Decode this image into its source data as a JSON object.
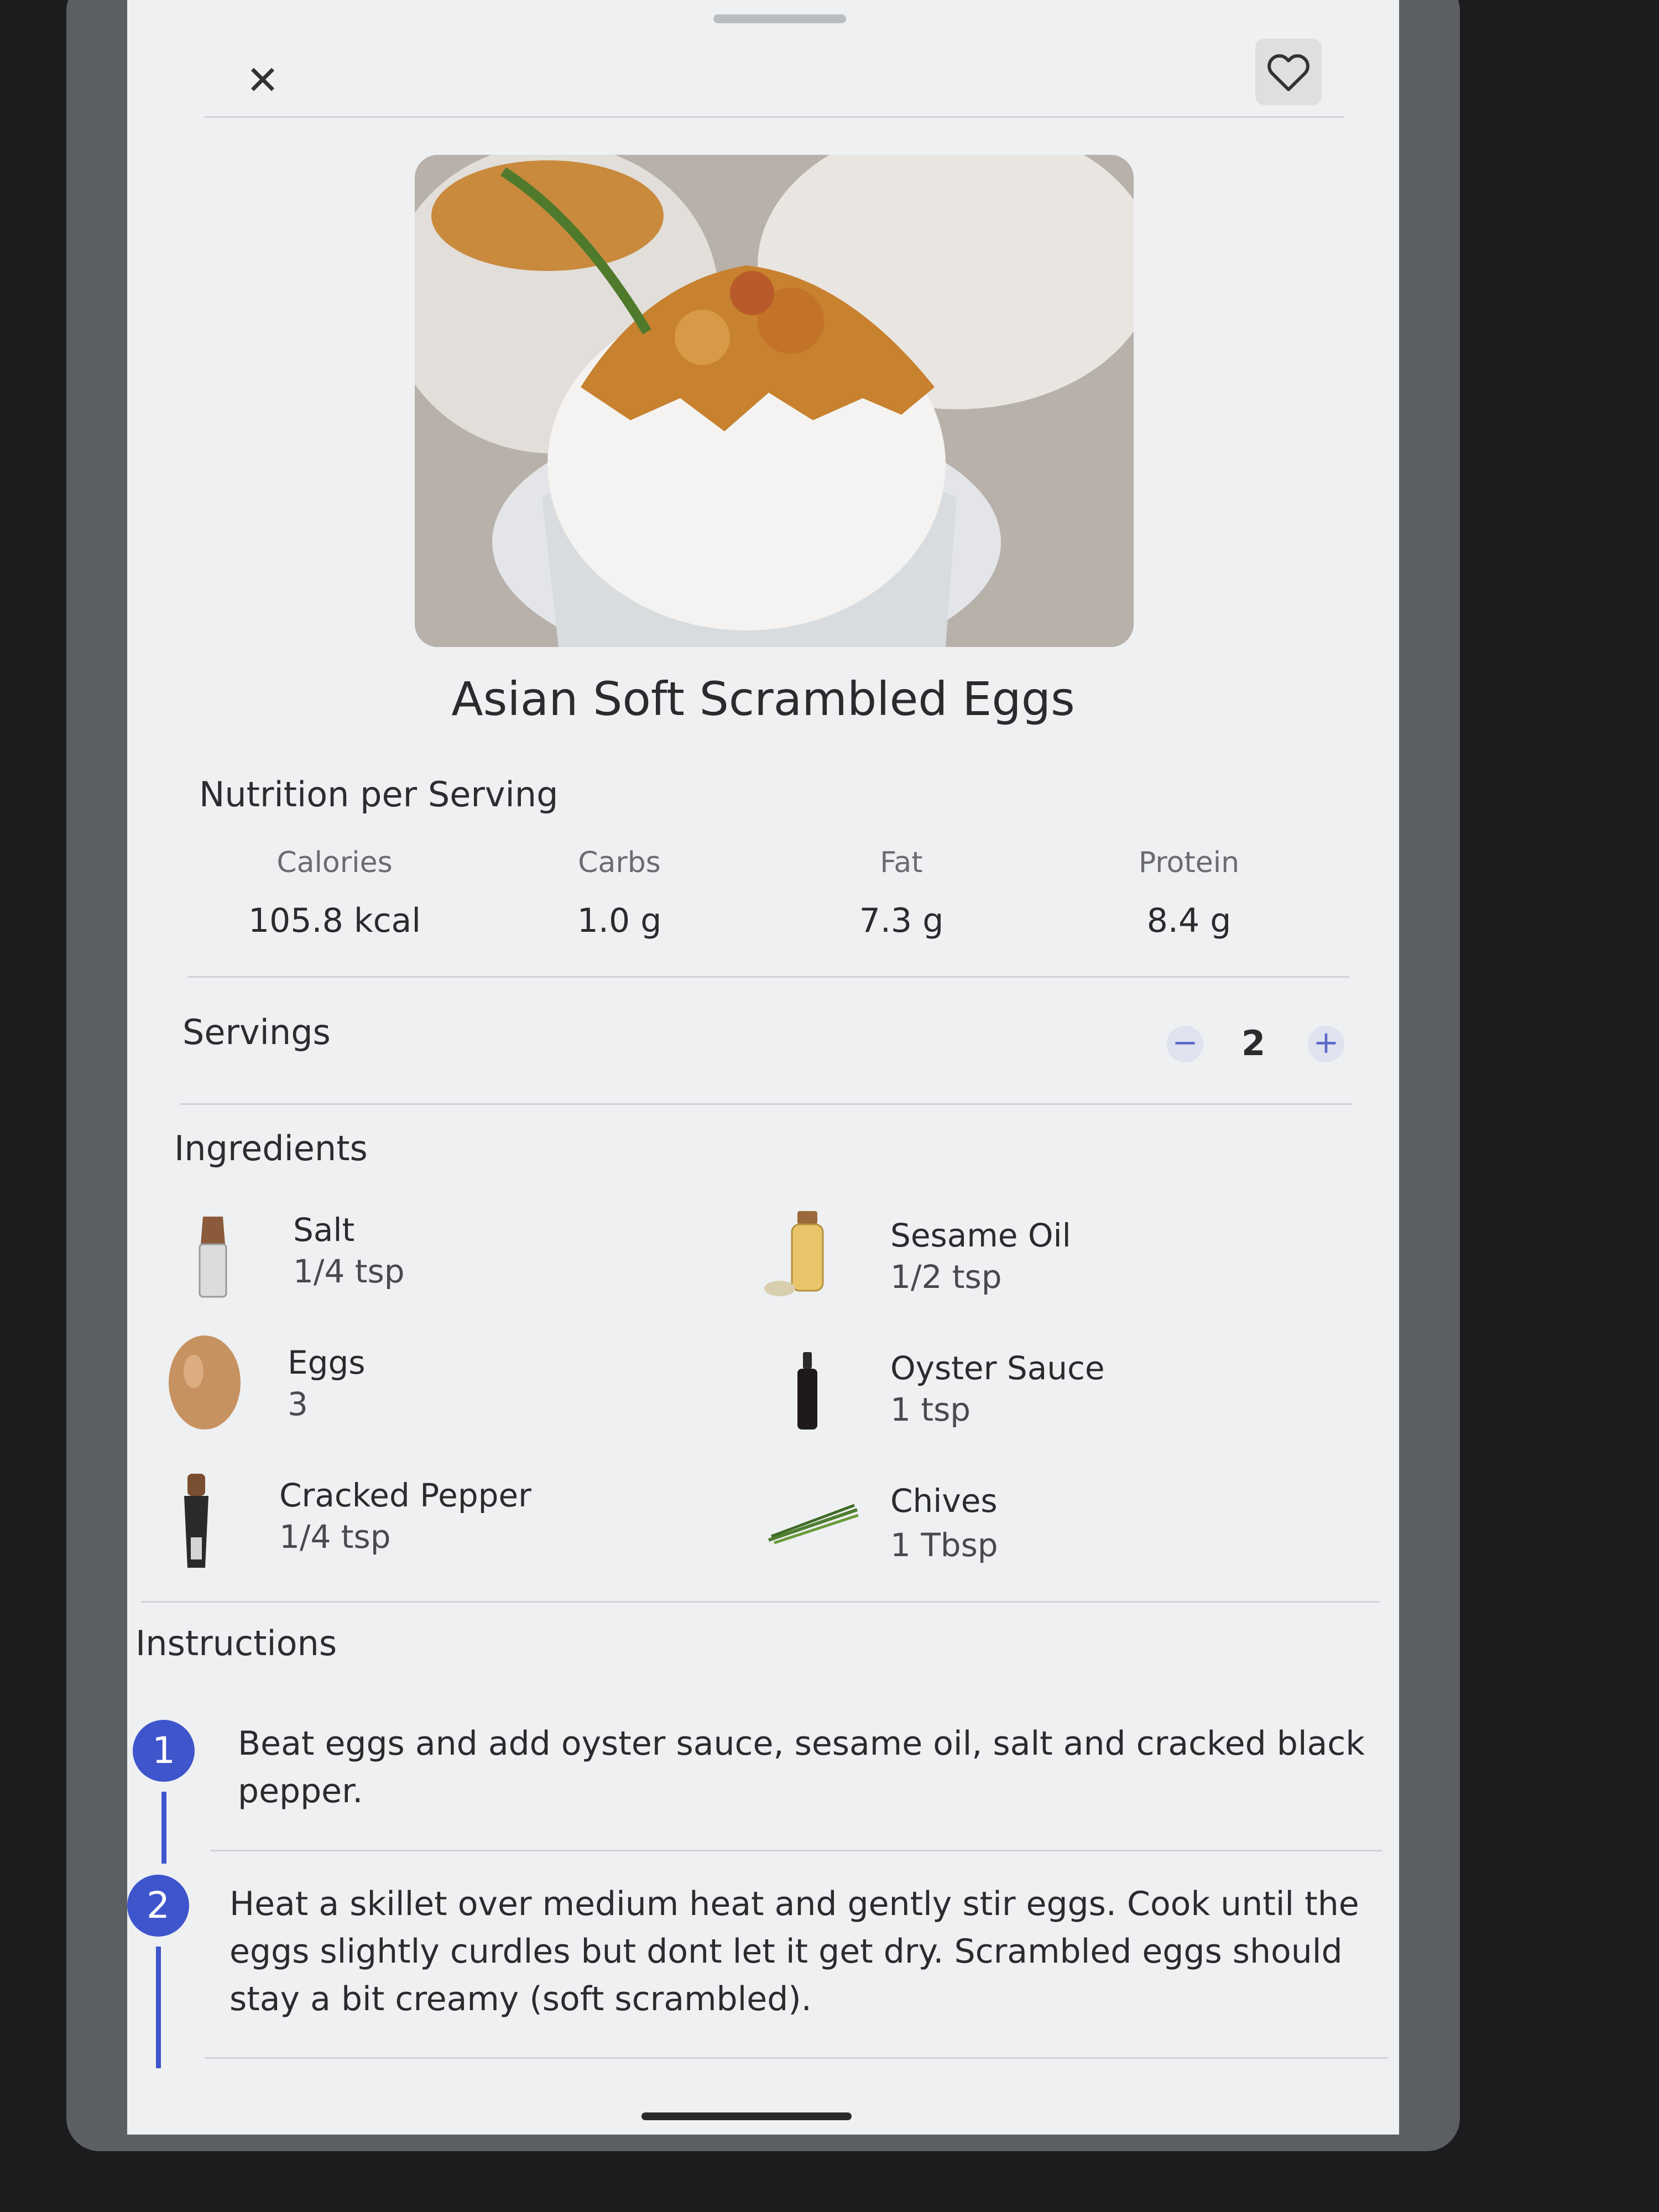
{
  "header": {
    "close_icon": "close-icon",
    "favorite_icon": "heart-outline-icon"
  },
  "recipe": {
    "title": "Asian Soft Scrambled Eggs"
  },
  "nutrition": {
    "title": "Nutrition per Serving",
    "items": [
      {
        "label": "Calories",
        "value": "105.8 kcal"
      },
      {
        "label": "Carbs",
        "value": "1.0 g"
      },
      {
        "label": "Fat",
        "value": "7.3 g"
      },
      {
        "label": "Protein",
        "value": "8.4 g"
      }
    ]
  },
  "servings": {
    "label": "Servings",
    "value": "2",
    "minus": "−",
    "plus": "+"
  },
  "ingredients": {
    "title": "Ingredients",
    "items": [
      {
        "name": "Salt",
        "qty": "1/4 tsp",
        "icon": "salt-shaker-icon"
      },
      {
        "name": "Sesame Oil",
        "qty": "1/2 tsp",
        "icon": "oil-bottle-icon"
      },
      {
        "name": "Eggs",
        "qty": "3",
        "icon": "egg-icon"
      },
      {
        "name": "Oyster Sauce",
        "qty": "1 tsp",
        "icon": "sauce-bottle-icon"
      },
      {
        "name": "Cracked Pepper",
        "qty": "1/4 tsp",
        "icon": "pepper-mill-icon"
      },
      {
        "name": "Chives",
        "qty": "1 Tbsp",
        "icon": "chives-icon"
      }
    ]
  },
  "instructions": {
    "title": "Instructions",
    "steps": [
      {
        "num": "1",
        "line1": "Beat eggs and add oyster sauce, sesame oil, salt and cracked black",
        "line2": "pepper."
      },
      {
        "num": "2",
        "line1": "Heat a skillet over medium heat and gently stir eggs. Cook until the",
        "line2": "eggs slightly curdles but dont let it get dry. Scrambled eggs should",
        "line3": "stay a bit creamy (soft scrambled)."
      }
    ]
  },
  "colors": {
    "accent": "#3f55cc",
    "background": "#eef0f2",
    "text": "#2b2b2e"
  }
}
